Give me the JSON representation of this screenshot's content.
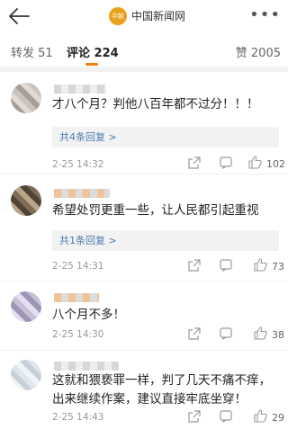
{
  "header": {
    "logo_text": "中新网",
    "site_name": "中国新闻网",
    "more": "•••"
  },
  "tabs": {
    "repost": "转发 51",
    "comments": "评论 224",
    "likes": "赞 2005"
  },
  "comments": [
    {
      "text": "才八个月？判他八百年都不过分！！！",
      "replies": "共4条回复 >",
      "time": "2-25 14:32",
      "like_count": "102"
    },
    {
      "text": "希望处罚更重一些，让人民都引起重视",
      "replies": "共1条回复 >",
      "time": "2-25 14:31",
      "like_count": "73"
    },
    {
      "text": "八个月不多！",
      "time": "2-25 14:30",
      "like_count": "38"
    },
    {
      "text": "这就和猥亵罪一样，判了几天不痛不痒，出来继续作案，建议直接牢底坐穿！",
      "time": "2-25 14:43",
      "like_count": "29"
    }
  ]
}
